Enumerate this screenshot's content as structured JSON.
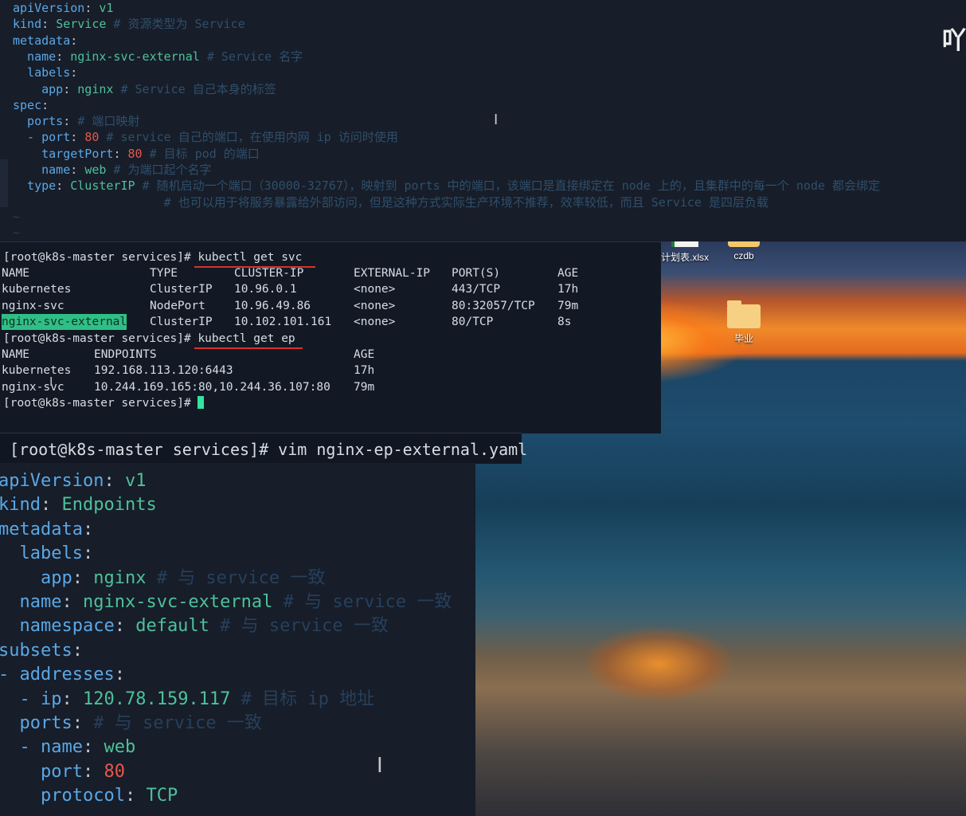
{
  "top_editor": {
    "corner_text": "吖",
    "lines": [
      {
        "key": "apiVersion",
        "sep": ": ",
        "val": "v1",
        "comment": ""
      },
      {
        "key": "kind",
        "sep": ": ",
        "val": "Service",
        "comment": " # 资源类型为 Service"
      },
      {
        "key": "metadata",
        "sep": ":",
        "val": "",
        "comment": ""
      },
      {
        "key": "  name",
        "sep": ": ",
        "val": "nginx-svc-external",
        "comment": " # Service 名字"
      },
      {
        "key": "  labels",
        "sep": ":",
        "val": "",
        "comment": ""
      },
      {
        "key": "    app",
        "sep": ": ",
        "val": "nginx",
        "comment": " # Service 自己本身的标签"
      },
      {
        "key": "spec",
        "sep": ":",
        "val": "",
        "comment": ""
      },
      {
        "key": "  ports",
        "sep": ":",
        "val": "",
        "comment": " # 端口映射"
      },
      {
        "key": "  - port",
        "sep": ": ",
        "val": "80",
        "comment": " # service 自己的端口，在使用内网 ip 访问时使用"
      },
      {
        "key": "    targetPort",
        "sep": ": ",
        "val": "80",
        "comment": " # 目标 pod 的端口"
      },
      {
        "key": "    name",
        "sep": ": ",
        "val": "web",
        "comment": " # 为端口起个名字"
      },
      {
        "key": "  type",
        "sep": ": ",
        "val": "ClusterIP",
        "comment": " # 随机启动一个端口（30000-32767），映射到 ports 中的端口，该端口是直接绑定在 node 上的，且集群中的每一个 node 都会绑定"
      },
      {
        "key": "",
        "sep": "",
        "val": "",
        "comment": "                     # 也可以用于将服务暴露给外部访问，但是这种方式实际生产环境不推荐，效率较低，而且 Service 是四层负载"
      }
    ],
    "tildes": [
      "~",
      "~"
    ]
  },
  "desktop": {
    "icons": [
      {
        "label": "计划表.xlsx"
      },
      {
        "label": "czdb"
      },
      {
        "label": "毕业"
      }
    ]
  },
  "terminal": {
    "prompt": "[root@k8s-master services]# ",
    "cmd1": "kubectl get svc",
    "svc_headers": [
      "NAME",
      "TYPE",
      "CLUSTER-IP",
      "EXTERNAL-IP",
      "PORT(S)",
      "AGE"
    ],
    "svc_rows": [
      [
        "kubernetes",
        "ClusterIP",
        "10.96.0.1",
        "<none>",
        "443/TCP",
        "17h"
      ],
      [
        "nginx-svc",
        "NodePort",
        "10.96.49.86",
        "<none>",
        "80:32057/TCP",
        "79m"
      ],
      [
        "nginx-svc-external",
        "ClusterIP",
        "10.102.101.161",
        "<none>",
        "80/TCP",
        "8s"
      ]
    ],
    "cmd2": "kubectl get ep",
    "ep_headers": [
      "NAME",
      "ENDPOINTS",
      "AGE"
    ],
    "ep_rows": [
      [
        "kubernetes",
        "192.168.113.120:6443",
        "17h"
      ],
      [
        "nginx-svc",
        "10.244.169.165:80,10.244.36.107:80",
        "79m"
      ]
    ]
  },
  "banner": {
    "text": "[root@k8s-master services]# vim nginx-ep-external.yaml"
  },
  "bottom_editor": {
    "lines": [
      {
        "key": "apiVersion",
        "sep": ": ",
        "val": "v1",
        "comment": "",
        "cls": "v"
      },
      {
        "key": "kind",
        "sep": ": ",
        "val": "Endpoints",
        "comment": "",
        "cls": "v"
      },
      {
        "key": "metadata",
        "sep": ":",
        "val": "",
        "comment": "",
        "cls": "v"
      },
      {
        "key": "  labels",
        "sep": ":",
        "val": "",
        "comment": "",
        "cls": "v"
      },
      {
        "key": "    app",
        "sep": ": ",
        "val": "nginx",
        "comment": " # 与 service 一致",
        "cls": "v"
      },
      {
        "key": "  name",
        "sep": ": ",
        "val": "nginx-svc-external",
        "comment": " # 与 service 一致",
        "cls": "v"
      },
      {
        "key": "  namespace",
        "sep": ": ",
        "val": "default",
        "comment": " # 与 service 一致",
        "cls": "v"
      },
      {
        "key": "subsets",
        "sep": ":",
        "val": "",
        "comment": "",
        "cls": "v"
      },
      {
        "key": "- addresses",
        "sep": ":",
        "val": "",
        "comment": "",
        "cls": "v"
      },
      {
        "key": "  - ip",
        "sep": ": ",
        "val": "120.78.159.117",
        "comment": " # 目标 ip 地址",
        "cls": "v"
      },
      {
        "key": "  ports",
        "sep": ":",
        "val": "",
        "comment": " # 与 service 一致",
        "cls": "v"
      },
      {
        "key": "  - name",
        "sep": ": ",
        "val": "web",
        "comment": "",
        "cls": "v"
      },
      {
        "key": "    port",
        "sep": ": ",
        "val": "80",
        "comment": "",
        "cls": "n"
      },
      {
        "key": "    protocol",
        "sep": ": ",
        "val": "TCP",
        "comment": "",
        "cls": "v"
      }
    ]
  }
}
